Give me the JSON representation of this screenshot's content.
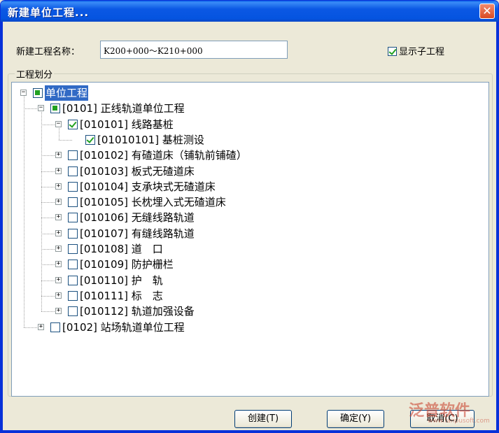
{
  "window": {
    "title": "新建单位工程...",
    "close_glyph": "✕"
  },
  "form": {
    "name_label": "新建工程名称：",
    "name_value": "K200+000～K210+000",
    "show_sub_label": "显示子工程",
    "show_sub_checked": true
  },
  "group": {
    "legend": "工程划分"
  },
  "tree": {
    "nodes": [
      {
        "text": "单位工程",
        "state": "partial",
        "expanded": true,
        "selected": true
      },
      {
        "text": "[0101] 正线轨道单位工程",
        "state": "partial",
        "expanded": true
      },
      {
        "text": "[010101] 线路基桩",
        "state": "checked",
        "expanded": true
      },
      {
        "text": "[01010101] 基桩测设",
        "state": "checked",
        "leaf": true
      },
      {
        "text": "[010102] 有碴道床（铺轨前铺碴）",
        "state": "unchecked",
        "expanded": false
      },
      {
        "text": "[010103] 板式无碴道床",
        "state": "unchecked",
        "expanded": false
      },
      {
        "text": "[010104] 支承块式无碴道床",
        "state": "unchecked",
        "expanded": false
      },
      {
        "text": "[010105] 长枕埋入式无碴道床",
        "state": "unchecked",
        "expanded": false
      },
      {
        "text": "[010106] 无缝线路轨道",
        "state": "unchecked",
        "expanded": false
      },
      {
        "text": "[010107] 有缝线路轨道",
        "state": "unchecked",
        "expanded": false
      },
      {
        "text": "[010108] 道　口",
        "state": "unchecked",
        "expanded": false
      },
      {
        "text": "[010109] 防护栅栏",
        "state": "unchecked",
        "expanded": false
      },
      {
        "text": "[010110] 护　轨",
        "state": "unchecked",
        "expanded": false
      },
      {
        "text": "[010111] 标　志",
        "state": "unchecked",
        "expanded": false
      },
      {
        "text": "[010112] 轨道加强设备",
        "state": "unchecked",
        "expanded": false
      },
      {
        "text": "[0102] 站场轨道单位工程",
        "state": "unchecked",
        "expanded": false
      }
    ]
  },
  "buttons": {
    "create": "创建(T)",
    "ok": "确定(Y)",
    "cancel": "取消(C)"
  },
  "watermark": {
    "text": "泛普软件",
    "sub": "www.fanpusoft.com"
  }
}
